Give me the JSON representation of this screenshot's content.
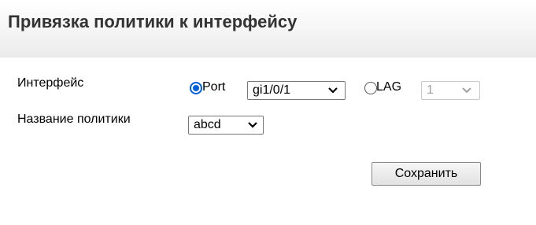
{
  "header": {
    "title": "Привязка политики к интерфейсу"
  },
  "form": {
    "interface_label": "Интерфейс",
    "port_radio_label": "Port",
    "port_selected": true,
    "port_select_value": "gi1/0/1",
    "lag_radio_label": "LAG",
    "lag_selected": false,
    "lag_select_value": "1",
    "policy_name_label": "Название политики",
    "policy_select_value": "abcd",
    "save_button_label": "Сохранить"
  },
  "colors": {
    "radio_accent": "#0060df"
  }
}
